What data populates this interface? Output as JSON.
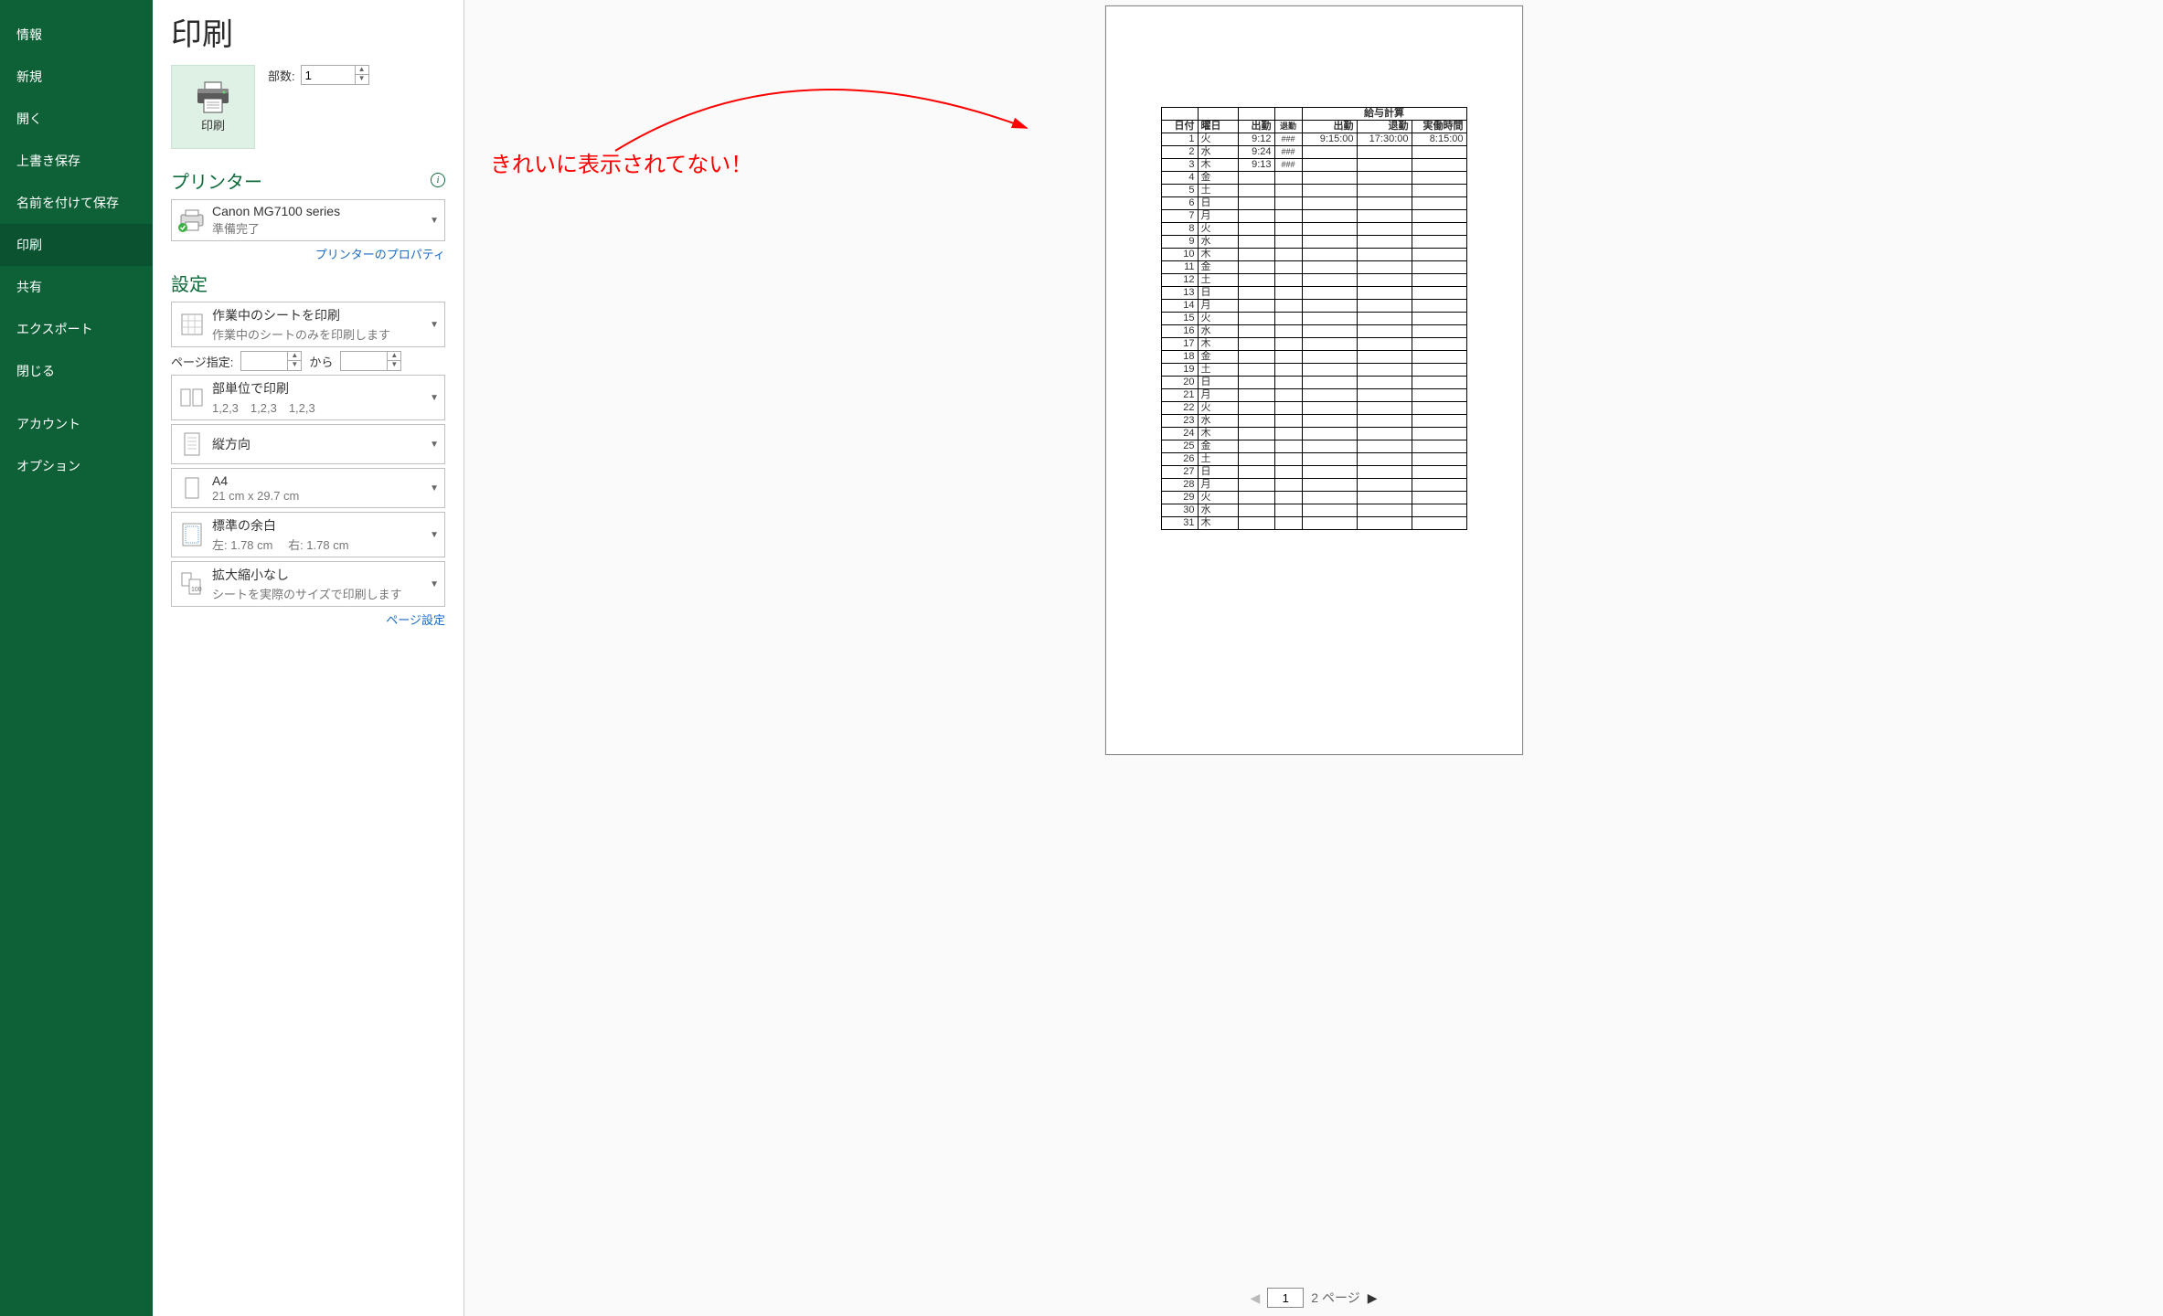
{
  "sidebar": {
    "items": [
      {
        "label": "情報"
      },
      {
        "label": "新規"
      },
      {
        "label": "開く"
      },
      {
        "label": "上書き保存"
      },
      {
        "label": "名前を付けて保存"
      },
      {
        "label": "印刷"
      },
      {
        "label": "共有"
      },
      {
        "label": "エクスポート"
      },
      {
        "label": "閉じる"
      },
      {
        "label": "アカウント"
      },
      {
        "label": "オプション"
      }
    ]
  },
  "header": {
    "title": "印刷"
  },
  "print": {
    "button_label": "印刷",
    "copies_label": "部数:",
    "copies_value": "1"
  },
  "printer": {
    "section_title": "プリンター",
    "name": "Canon MG7100 series",
    "status": "準備完了",
    "properties_link": "プリンターのプロパティ"
  },
  "settings": {
    "section_title": "設定",
    "scope": {
      "title": "作業中のシートを印刷",
      "sub": "作業中のシートのみを印刷します"
    },
    "page_range_label": "ページ指定:",
    "page_range_sep": "から",
    "collate": {
      "title": "部単位で印刷",
      "sub": "1,2,3　1,2,3　1,2,3"
    },
    "orientation": {
      "title": "縦方向"
    },
    "paper": {
      "title": "A4",
      "sub": "21 cm x 29.7 cm"
    },
    "margin": {
      "title": "標準の余白",
      "sub": "左:  1.78 cm　 右:  1.78 cm"
    },
    "scale": {
      "title": "拡大縮小なし",
      "sub": "シートを実際のサイズで印刷します"
    },
    "page_setup_link": "ページ設定"
  },
  "annotation": {
    "text": "きれいに表示されてない！"
  },
  "preview_table": {
    "merged_header": "給与計算",
    "cols": [
      "日付",
      "曜日",
      "出勤",
      "退勤",
      "出勤",
      "退勤",
      "実働時間"
    ],
    "rows": [
      {
        "d": "1",
        "y": "火",
        "c1": "9:12",
        "c2": "###",
        "c3": "9:15:00",
        "c4": "17:30:00",
        "c5": "8:15:00"
      },
      {
        "d": "2",
        "y": "水",
        "c1": "9:24",
        "c2": "###",
        "c3": "",
        "c4": "",
        "c5": ""
      },
      {
        "d": "3",
        "y": "木",
        "c1": "9:13",
        "c2": "###",
        "c3": "",
        "c4": "",
        "c5": ""
      },
      {
        "d": "4",
        "y": "金"
      },
      {
        "d": "5",
        "y": "土"
      },
      {
        "d": "6",
        "y": "日"
      },
      {
        "d": "7",
        "y": "月"
      },
      {
        "d": "8",
        "y": "火"
      },
      {
        "d": "9",
        "y": "水"
      },
      {
        "d": "10",
        "y": "木"
      },
      {
        "d": "11",
        "y": "金"
      },
      {
        "d": "12",
        "y": "土"
      },
      {
        "d": "13",
        "y": "日"
      },
      {
        "d": "14",
        "y": "月"
      },
      {
        "d": "15",
        "y": "火"
      },
      {
        "d": "16",
        "y": "水"
      },
      {
        "d": "17",
        "y": "木"
      },
      {
        "d": "18",
        "y": "金"
      },
      {
        "d": "19",
        "y": "土"
      },
      {
        "d": "20",
        "y": "日"
      },
      {
        "d": "21",
        "y": "月"
      },
      {
        "d": "22",
        "y": "火"
      },
      {
        "d": "23",
        "y": "水"
      },
      {
        "d": "24",
        "y": "木"
      },
      {
        "d": "25",
        "y": "金"
      },
      {
        "d": "26",
        "y": "土"
      },
      {
        "d": "27",
        "y": "日"
      },
      {
        "d": "28",
        "y": "月"
      },
      {
        "d": "29",
        "y": "火"
      },
      {
        "d": "30",
        "y": "水"
      },
      {
        "d": "31",
        "y": "木"
      }
    ]
  },
  "pager": {
    "current": "1",
    "total_label": "2 ページ"
  }
}
